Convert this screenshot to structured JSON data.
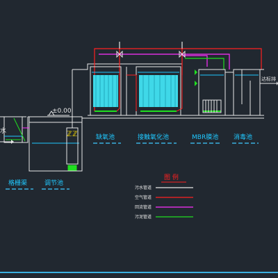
{
  "labels": {
    "level_mark": "±0.00",
    "inlet": "水",
    "discharge": "达标排",
    "grating": "格栅渠",
    "regulating": "调节池",
    "anoxic": "缺氧池",
    "contact_oxidation": "接触氧化池",
    "mbr": "MBR膜池",
    "disinfection": "消毒池"
  },
  "legend": {
    "title": "图 例",
    "items": [
      {
        "label": "污水管道",
        "color": "#e8e8e8"
      },
      {
        "label": "空气管道",
        "color": "#ff2020"
      },
      {
        "label": "回流管道",
        "color": "#ff30ff"
      },
      {
        "label": "污泥管道",
        "color": "#20e020"
      }
    ]
  },
  "colors": {
    "background": "#212830",
    "structure": "#e8e8e8",
    "water_line": "#20c8ff",
    "label_text": "#20c8ff",
    "label_underline": "#3ab0e0",
    "legend_title": "#ff2020",
    "media_fill": "#3fd8e8",
    "bottom_rule": "#3ab0e0"
  },
  "icons": [
    "pump-icon",
    "valve-icon",
    "membrane-module-icon",
    "aeration-icon"
  ]
}
